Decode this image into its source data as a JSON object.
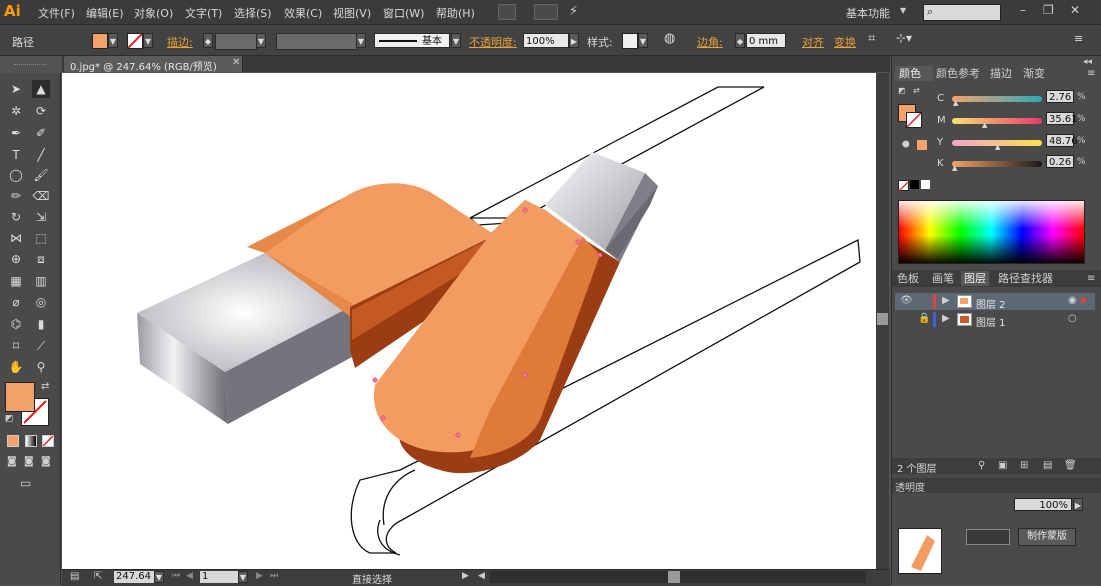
{
  "app": {
    "logo": "Ai"
  },
  "menubar": {
    "items": [
      "文件(F)",
      "编辑(E)",
      "对象(O)",
      "文字(T)",
      "选择(S)",
      "效果(C)",
      "视图(V)",
      "窗口(W)",
      "帮助(H)"
    ],
    "workspace": "基本功能"
  },
  "controlbar": {
    "selection_label": "路径",
    "stroke_label": "描边:",
    "stroke_style": "基本",
    "opacity_label": "不透明度:",
    "opacity_value": "100%",
    "style_label": "样式:",
    "corner_label": "边角:",
    "corner_value": "0 mm",
    "align_label": "对齐",
    "transform_label": "变换",
    "fill_color": "#f4a26a"
  },
  "document": {
    "tab_title": "0.jpg* @ 247.64% (RGB/预览)"
  },
  "statusbar": {
    "zoom": "247.64",
    "artboard": "1",
    "tool": "直接选择"
  },
  "panels": {
    "color_tabs": [
      "颜色",
      "颜色参考",
      "描边",
      "渐变"
    ],
    "cmyk": [
      {
        "label": "C",
        "value": "2.76"
      },
      {
        "label": "M",
        "value": "35.61"
      },
      {
        "label": "Y",
        "value": "48.76"
      },
      {
        "label": "K",
        "value": "0.26"
      }
    ],
    "cmyk_unit": "%",
    "layer_tabs": [
      "色板",
      "画笔",
      "图层",
      "路径查找器"
    ],
    "layers": [
      {
        "name": "图层 2",
        "color": "#e04040"
      },
      {
        "name": "图层 1",
        "color": "#4060e0"
      }
    ],
    "layer_count": "2 个图层",
    "bottom": {
      "partial_label": "透明度",
      "opacity": "100%",
      "make_mask": "制作蒙版"
    }
  },
  "colors": {
    "orange": "#f4a26a",
    "orange_mid": "#e07a3a",
    "orange_dark": "#9c3c12",
    "gray_light": "#eeeef2",
    "gray_mid": "#a8a8b0",
    "gray_dark": "#6a6a72"
  }
}
